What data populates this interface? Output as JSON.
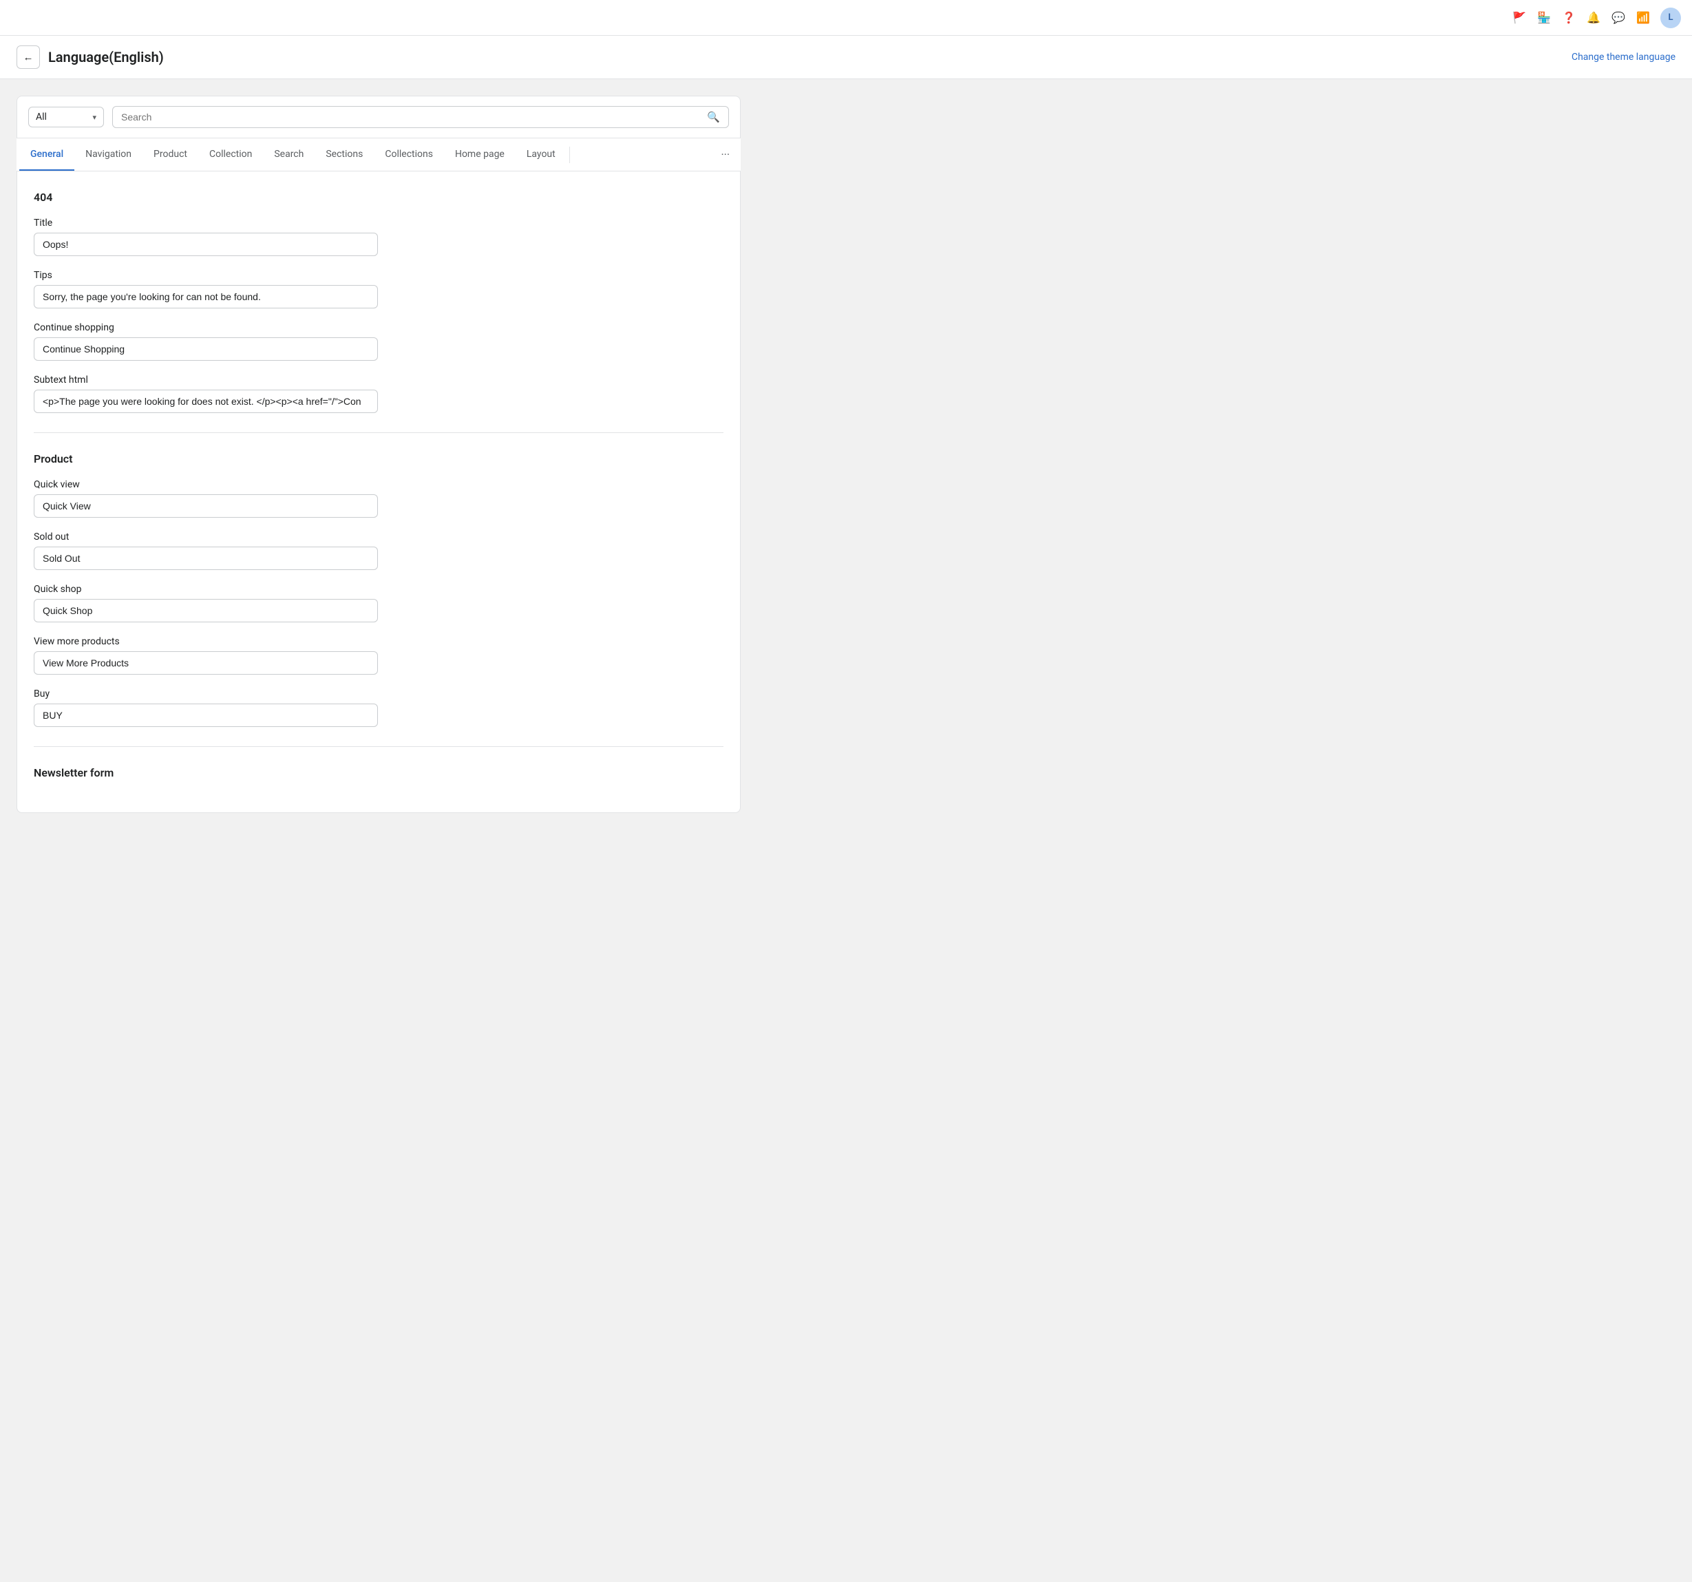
{
  "topbar": {
    "avatar_label": "L"
  },
  "header": {
    "back_button_label": "←",
    "title": "Language(English)",
    "change_lang_label": "Change theme language"
  },
  "filter": {
    "select_label": "All",
    "search_placeholder": "Search"
  },
  "tabs": [
    {
      "label": "General",
      "active": true
    },
    {
      "label": "Navigation",
      "active": false
    },
    {
      "label": "Product",
      "active": false
    },
    {
      "label": "Collection",
      "active": false
    },
    {
      "label": "Search",
      "active": false
    },
    {
      "label": "Sections",
      "active": false
    },
    {
      "label": "Collections",
      "active": false
    },
    {
      "label": "Home page",
      "active": false
    },
    {
      "label": "Layout",
      "active": false
    }
  ],
  "section_404": {
    "heading": "404",
    "title_label": "Title",
    "title_value": "Oops!",
    "tips_label": "Tips",
    "tips_value": "Sorry, the page you're looking for can not be found.",
    "continue_shopping_label": "Continue shopping",
    "continue_shopping_value": "Continue Shopping",
    "subtext_html_label": "Subtext html",
    "subtext_html_value": "<p>The page you were looking for does not exist. </p><p><a href=\"/\">Con"
  },
  "section_product": {
    "heading": "Product",
    "quick_view_label": "Quick view",
    "quick_view_value": "Quick View",
    "sold_out_label": "Sold out",
    "sold_out_value": "Sold Out",
    "quick_shop_label": "Quick shop",
    "quick_shop_value": "Quick Shop",
    "view_more_products_label": "View more products",
    "view_more_products_value": "View More Products",
    "buy_label": "Buy",
    "buy_value": "BUY"
  },
  "section_newsletter": {
    "heading": "Newsletter form"
  }
}
